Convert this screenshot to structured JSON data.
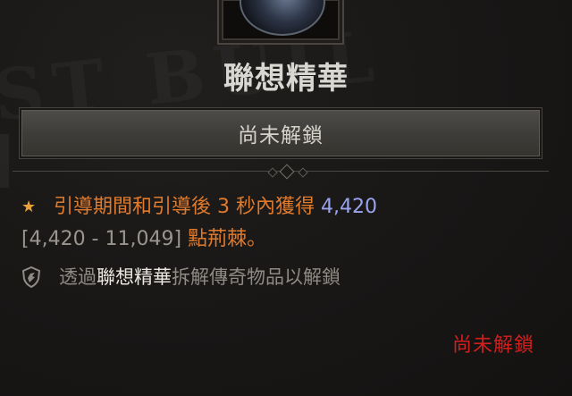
{
  "item": {
    "name": "聯想精華",
    "status_label": "尚未解鎖"
  },
  "affix": {
    "prefix": "引導期間和引導後 3 秒內獲得",
    "value": "4,420",
    "range": "[4,420 - 11,049]",
    "suffix": "點荊棘。"
  },
  "unlock_hint": {
    "before": "透過",
    "highlight": "聯想精華",
    "after": "拆解傳奇物品以解鎖"
  },
  "footer": {
    "status": "尚未解鎖"
  },
  "colors": {
    "affix_orange": "#e07a2c",
    "value_blue": "#9aa3ee",
    "locked_red": "#d01f1f",
    "star_gold": "#e8a23a"
  },
  "icons": {
    "bullet": "star-icon",
    "unlock": "shield-icon",
    "item": "gem-icon"
  }
}
